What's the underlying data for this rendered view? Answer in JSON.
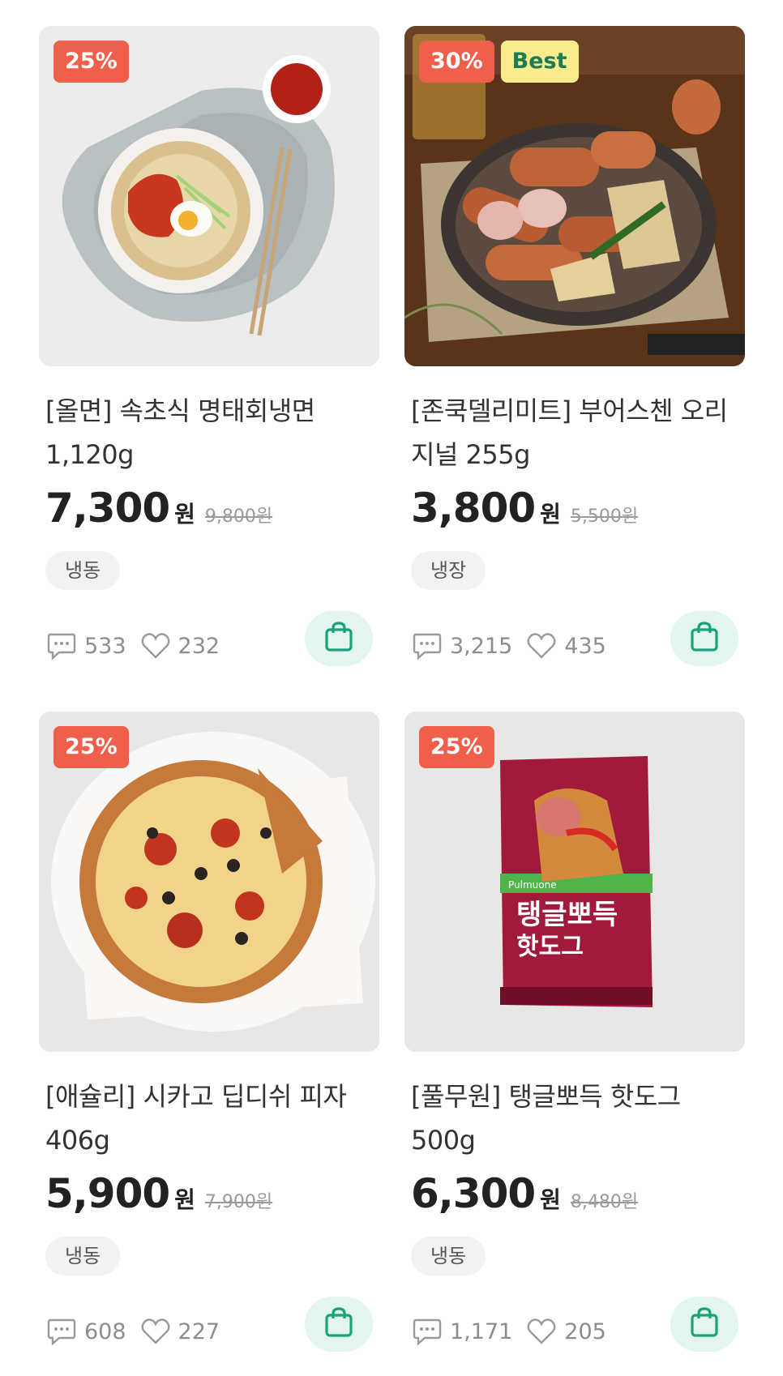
{
  "products": [
    {
      "discount": "25%",
      "best": "",
      "name": "[올면] 속초식 명태회냉면 1,120g",
      "price": "7,300",
      "won": "원",
      "original": "9,800원",
      "storage": "냉동",
      "reviews": "533",
      "likes": "232"
    },
    {
      "discount": "30%",
      "best": "Best",
      "name": "[존쿡델리미트] 부어스첸 오리지널 255g",
      "price": "3,800",
      "won": "원",
      "original": "5,500원",
      "storage": "냉장",
      "reviews": "3,215",
      "likes": "435"
    },
    {
      "discount": "25%",
      "best": "",
      "name": "[애슐리] 시카고 딥디쉬 피자 406g",
      "price": "5,900",
      "won": "원",
      "original": "7,900원",
      "storage": "냉동",
      "reviews": "608",
      "likes": "227"
    },
    {
      "discount": "25%",
      "best": "",
      "name": "[풀무원] 탱글뽀득 핫도그 500g",
      "price": "6,300",
      "won": "원",
      "original": "8,480원",
      "storage": "냉동",
      "reviews": "1,171",
      "likes": "205"
    }
  ],
  "package_text": {
    "brand": "Pulmuone",
    "title_line1": "탱글뽀득",
    "title_line2": "핫도그"
  },
  "icons": {
    "review": "speech-bubble-icon",
    "like": "heart-icon",
    "cart": "shopping-bag-icon"
  },
  "colors": {
    "discount_badge": "#f05f4c",
    "best_badge_bg": "#f8ec8e",
    "best_badge_text": "#1c7a55",
    "cart_bg": "#e3f5ef",
    "cart_icon": "#1aa37a"
  }
}
